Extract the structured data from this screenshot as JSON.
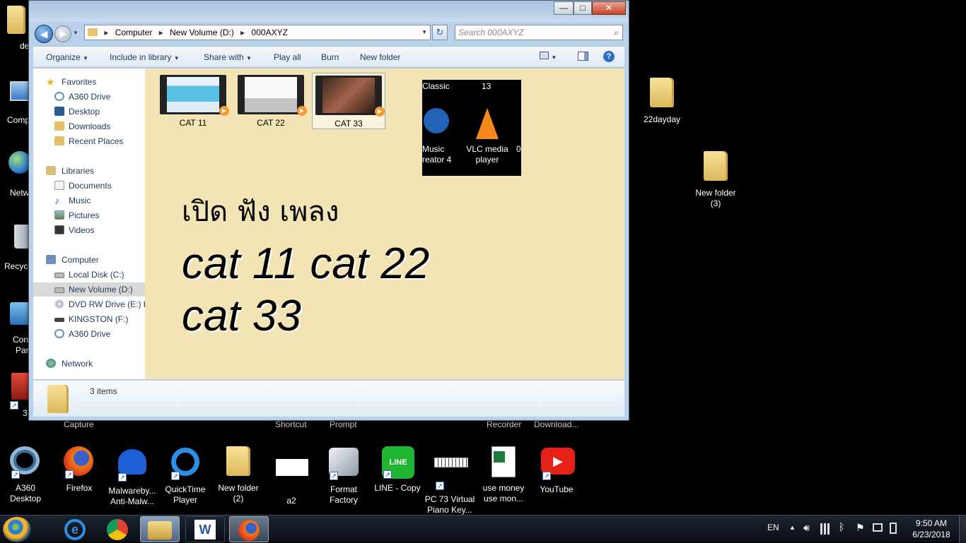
{
  "window": {
    "breadcrumb": [
      "Computer",
      "New Volume (D:)",
      "000AXYZ"
    ],
    "search_placeholder": "Search 000AXYZ",
    "controls": {
      "minimize": "—",
      "maximize": "□",
      "close": "✕"
    },
    "toolbar": [
      "Organize",
      "Include in library",
      "Share with",
      "Play all",
      "Burn",
      "New folder"
    ],
    "nav": {
      "favorites_header": "Favorites",
      "favorites": [
        "A360 Drive",
        "Desktop",
        "Downloads",
        "Recent Places"
      ],
      "libraries_header": "Libraries",
      "libraries": [
        "Documents",
        "Music",
        "Pictures",
        "Videos"
      ],
      "computer_header": "Computer",
      "computer": [
        "Local Disk (C:)",
        "New Volume (D:)",
        "DVD RW Drive (E:) Ba",
        "KINGSTON (F:)",
        "A360 Drive"
      ],
      "network": "Network"
    },
    "files": [
      "CAT 11",
      "CAT 22",
      "CAT 33"
    ],
    "overlay_icons": {
      "top_labels": [
        "Classic",
        "13"
      ],
      "items": [
        "Music\nreator 4",
        "VLC media\nplayer"
      ],
      "edge_char": "0"
    },
    "overlay_text": {
      "thai": "เปิด ฟัง เพลง",
      "line1": "cat 11 cat 22",
      "line2": "cat 33"
    },
    "status": "3 items"
  },
  "desktop": {
    "left_partial": [
      "de",
      "Comp",
      "Netw",
      "Recyc",
      "Con",
      "Par",
      "3"
    ],
    "right_icons": [
      "22dayday",
      "New folder\n(3)"
    ],
    "behind_labels": [
      "Capture",
      "Shortcut",
      "Prompt",
      "Recorder",
      "Download..."
    ],
    "row_icons": [
      "A360\nDesktop",
      "Firefox",
      "Malwareby...\nAnti-Malw...",
      "QuickTime\nPlayer",
      "New folder\n(2)",
      "a2",
      "Format\nFactory",
      "LINE - Copy",
      "PC 73 Virtual\nPiano Key...",
      "use money\nuse mon...",
      "YouTube"
    ]
  },
  "taskbar": {
    "lang": "EN",
    "time": "9:50 AM",
    "date": "6/23/2018"
  }
}
